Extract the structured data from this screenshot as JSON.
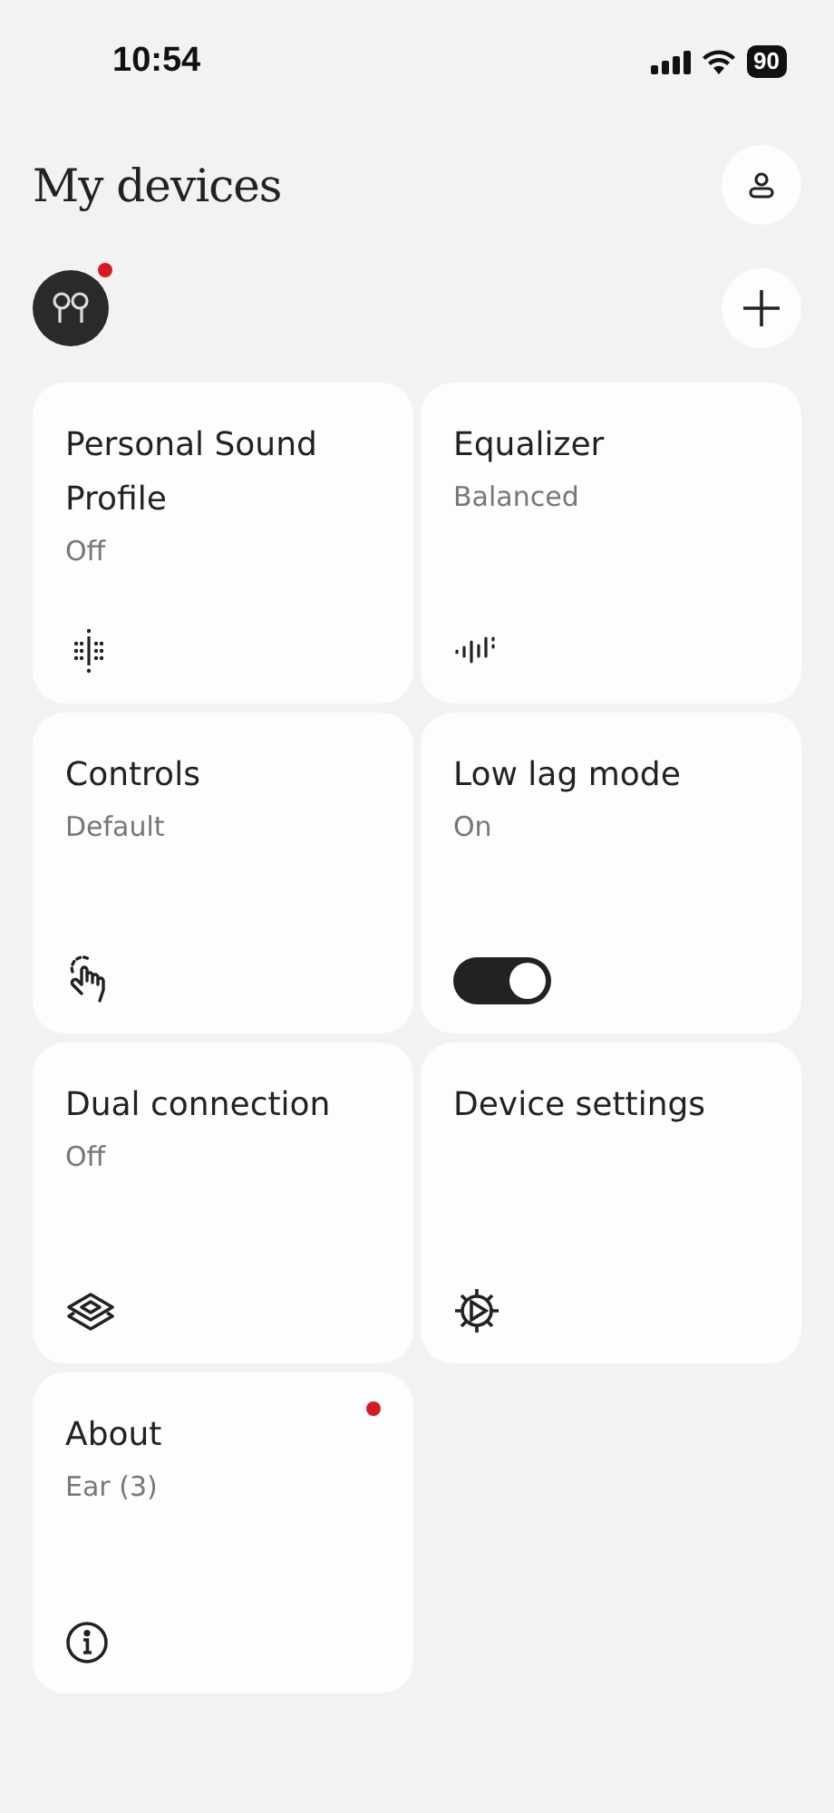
{
  "status_bar": {
    "time": "10:54",
    "battery": "90"
  },
  "title": "My devices",
  "device": {
    "notification": true
  },
  "cards": [
    {
      "kind": "sound-profile",
      "title": "Personal Sound Profile",
      "subtitle": "Off"
    },
    {
      "kind": "equalizer",
      "title": "Equalizer",
      "subtitle": "Balanced"
    },
    {
      "kind": "controls",
      "title": "Controls",
      "subtitle": "Default"
    },
    {
      "kind": "toggle",
      "title": "Low lag mode",
      "subtitle": "On",
      "on": true
    },
    {
      "kind": "dual",
      "title": "Dual connection",
      "subtitle": "Off"
    },
    {
      "kind": "settings",
      "title": "Device settings"
    },
    {
      "kind": "about",
      "title": "About",
      "subtitle": "Ear (3)",
      "notification": true
    }
  ]
}
